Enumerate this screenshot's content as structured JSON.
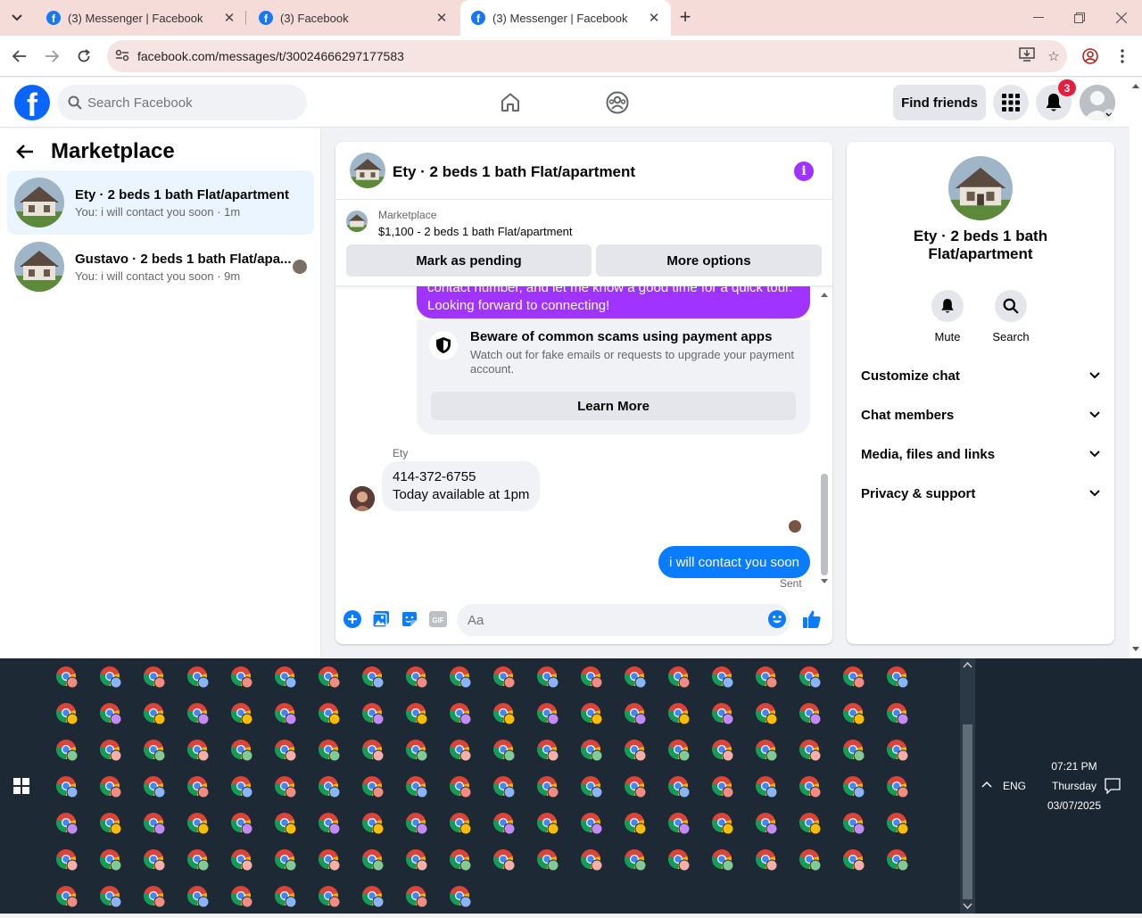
{
  "browser": {
    "tabs": [
      {
        "title": "(3) Messenger | Facebook"
      },
      {
        "title": "(3) Facebook"
      },
      {
        "title": "(3) Messenger | Facebook"
      }
    ],
    "url": "facebook.com/messages/t/30024666297177583"
  },
  "fb_header": {
    "logo": "f",
    "search_placeholder": "Search Facebook",
    "find_friends": "Find friends",
    "notification_count": "3"
  },
  "sidebar": {
    "title": "Marketplace",
    "conversations": [
      {
        "name": "Ety · 2 beds 1 bath Flat/apartment",
        "preview": "You: i will contact you soon · 1m"
      },
      {
        "name": "Gustavo · 2 beds 1 bath Flat/apa...",
        "preview": "You: i will contact you soon · 9m"
      }
    ]
  },
  "chat": {
    "title": "Ety · 2 beds 1 bath Flat/apartment",
    "marketplace_label": "Marketplace",
    "listing": "$1,100 - 2 beds 1 bath Flat/apartment",
    "mark_pending": "Mark as pending",
    "more_options": "More options",
    "partial_message_line1": "contact number, and let me know a good time for a quick tour.",
    "partial_message_line2": "Looking forward to connecting!",
    "scam_title": "Beware of common scams using payment apps",
    "scam_body": "Watch out for fake emails or requests to upgrade your payment account.",
    "learn_more": "Learn More",
    "sender": "Ety",
    "incoming_line1": "414-372-6755",
    "incoming_line2": "Today available at 1pm",
    "outgoing": "i will contact you soon",
    "status": "Sent",
    "composer_placeholder": "Aa"
  },
  "info_panel": {
    "title": "Ety · 2 beds 1 bath Flat/apartment",
    "actions": [
      {
        "label": "Mute"
      },
      {
        "label": "Search"
      }
    ],
    "sections": [
      {
        "label": "Customize chat"
      },
      {
        "label": "Chat members"
      },
      {
        "label": "Media, files and links"
      },
      {
        "label": "Privacy & support"
      }
    ]
  },
  "taskbar": {
    "time": "07:21 PM",
    "day": "Thursday",
    "date": "03/07/2025",
    "language": "ENG"
  },
  "colors": {
    "facebook_blue": "#0866ff",
    "messenger_purple": "#a033ff",
    "outgoing_blue": "#0a7cff",
    "badge_red": "#e41e3f"
  }
}
